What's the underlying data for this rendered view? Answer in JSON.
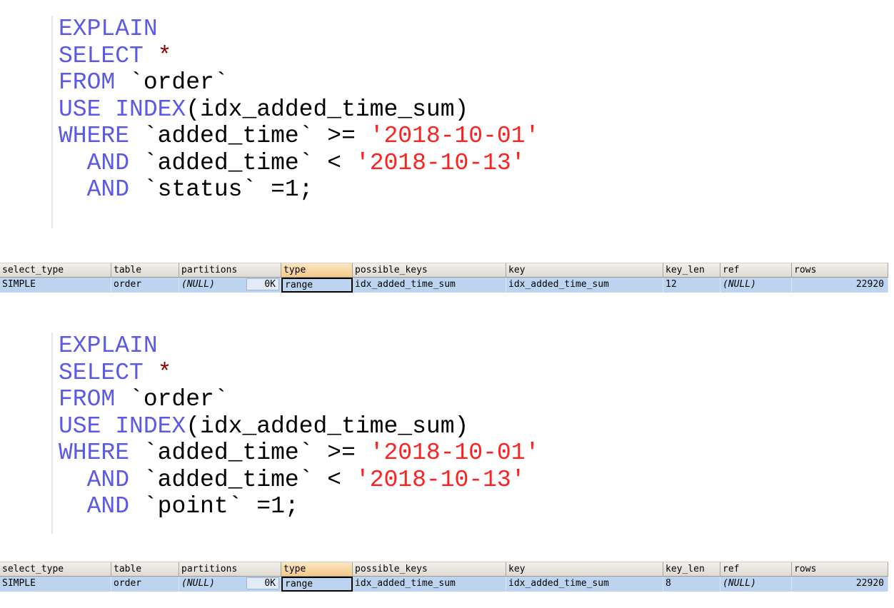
{
  "queries": [
    {
      "code": {
        "l1": "EXPLAIN",
        "l2_kw": "SELECT",
        "l2_star": " *",
        "l3_kw": "FROM",
        "l3_rest": " `order`",
        "l4_kw": "USE INDEX",
        "l4_rest": "(idx_added_time_sum)",
        "l5_kw": "WHERE",
        "l5_mid": " `added_time` >= ",
        "l5_str": "'2018-10-01'",
        "l6_kw": "  AND",
        "l6_mid": " `added_time` < ",
        "l6_str": "'2018-10-13'",
        "l7_kw": "  AND",
        "l7_rest": " `status` =1;"
      },
      "result": {
        "columns": [
          "select_type",
          "table",
          "partitions",
          "type",
          "possible_keys",
          "key",
          "key_len",
          "ref",
          "rows"
        ],
        "row": {
          "select_type": "SIMPLE",
          "table": "order",
          "partitions": "(NULL)",
          "partitions_badge": "0K",
          "type": "range",
          "possible_keys": "idx_added_time_sum",
          "key": "idx_added_time_sum",
          "key_len": "12",
          "ref": "(NULL)",
          "rows": "22920"
        }
      }
    },
    {
      "code": {
        "l1": "EXPLAIN",
        "l2_kw": "SELECT",
        "l2_star": " *",
        "l3_kw": "FROM",
        "l3_rest": " `order`",
        "l4_kw": "USE INDEX",
        "l4_rest": "(idx_added_time_sum)",
        "l5_kw": "WHERE",
        "l5_mid": " `added_time` >= ",
        "l5_str": "'2018-10-01'",
        "l6_kw": "  AND",
        "l6_mid": " `added_time` < ",
        "l6_str": "'2018-10-13'",
        "l7_kw": "  AND",
        "l7_rest": " `point` =1;"
      },
      "result": {
        "columns": [
          "select_type",
          "table",
          "partitions",
          "type",
          "possible_keys",
          "key",
          "key_len",
          "ref",
          "rows"
        ],
        "row": {
          "select_type": "SIMPLE",
          "table": "order",
          "partitions": "(NULL)",
          "partitions_badge": "0K",
          "type": "range",
          "possible_keys": "idx_added_time_sum",
          "key": "idx_added_time_sum",
          "key_len": "8",
          "ref": "(NULL)",
          "rows": "22920"
        }
      }
    }
  ],
  "colors": {
    "keyword": "#5a5ae6",
    "string": "#ff2020",
    "star": "#8b0000",
    "row_selected": "#bcd4f0",
    "header_sorted": "#f3c987"
  }
}
